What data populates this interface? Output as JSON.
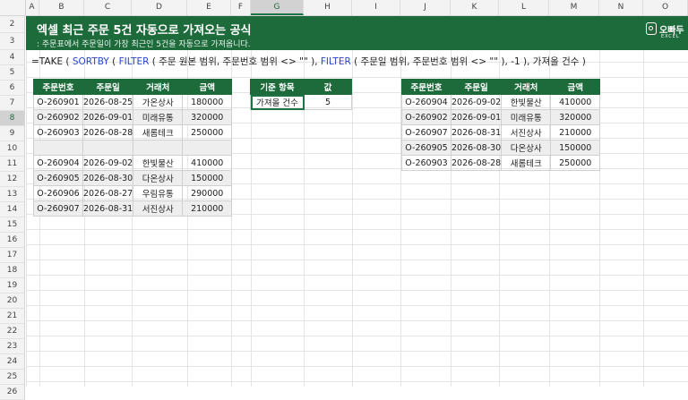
{
  "columns": [
    "A",
    "B",
    "C",
    "D",
    "E",
    "F",
    "G",
    "H",
    "I",
    "J",
    "K",
    "L",
    "M",
    "N",
    "O"
  ],
  "selected_column": "G",
  "rows": [
    "2",
    "3",
    "4",
    "5",
    "6",
    "7",
    "8",
    "9",
    "10",
    "11",
    "12",
    "13",
    "14",
    "15",
    "16",
    "17",
    "18",
    "19",
    "20",
    "21",
    "22",
    "23",
    "24",
    "25",
    "26"
  ],
  "selected_row": "8",
  "banner": {
    "title": "엑셀 최근 주문 5건 자동으로 가져오는 공식",
    "subtitle": ": 주문표에서 주문일이 가장 최근인 5건을 자동으로 가져옵니다.",
    "logo_name": "오빠두",
    "logo_sub": "EXCEL",
    "color": "#1d6b3b"
  },
  "formula": {
    "p1": "=TAKE ( ",
    "f1": "SORTBY",
    "p2": " ( ",
    "f2": "FILTER",
    "p3": " ( 주문 원본 범위, 주문번호 범위 <> \"\" ), ",
    "f3": "FILTER",
    "p4": " ( 주문일 범위, 주문번호 범위 <> \"\" ), -1 ), 가져올 건수 )"
  },
  "source_table": {
    "headers": [
      "주문번호",
      "주문일",
      "거래처",
      "금액"
    ],
    "rows": [
      [
        "O-260901",
        "2026-08-25",
        "가온상사",
        "180000"
      ],
      [
        "O-260902",
        "2026-09-01",
        "미래유통",
        "320000"
      ],
      [
        "O-260903",
        "2026-08-28",
        "새롬테크",
        "250000"
      ],
      [
        "",
        "",
        "",
        ""
      ],
      [
        "O-260904",
        "2026-09-02",
        "한빛물산",
        "410000"
      ],
      [
        "O-260905",
        "2026-08-30",
        "다온상사",
        "150000"
      ],
      [
        "O-260906",
        "2026-08-27",
        "우림유통",
        "290000"
      ],
      [
        "O-260907",
        "2026-08-31",
        "서진상사",
        "210000"
      ]
    ]
  },
  "criteria_table": {
    "headers": [
      "기준 항목",
      "값"
    ],
    "label": "가져올 건수",
    "value": "5"
  },
  "result_table": {
    "headers": [
      "주문번호",
      "주문일",
      "거래처",
      "금액"
    ],
    "rows": [
      [
        "O-260904",
        "2026-09-02",
        "한빛물산",
        "410000"
      ],
      [
        "O-260902",
        "2026-09-01",
        "미래유통",
        "320000"
      ],
      [
        "O-260907",
        "2026-08-31",
        "서진상사",
        "210000"
      ],
      [
        "O-260905",
        "2026-08-30",
        "다온상사",
        "150000"
      ],
      [
        "O-260903",
        "2026-08-28",
        "새롬테크",
        "250000"
      ]
    ]
  }
}
